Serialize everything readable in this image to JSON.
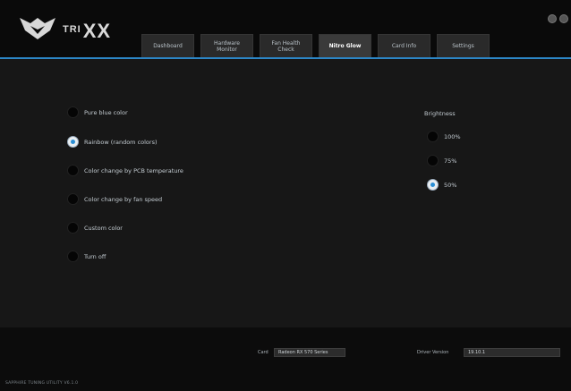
{
  "brand": {
    "prefix": "TRI",
    "main": "XX",
    "accent_color": "#2c86c6"
  },
  "tabs": [
    {
      "label": "Dashboard",
      "active": false
    },
    {
      "label": "Hardware Monitor",
      "active": false
    },
    {
      "label": "Fan Health Check",
      "active": false
    },
    {
      "label": "Nitro Glow",
      "active": true
    },
    {
      "label": "Card Info",
      "active": false
    },
    {
      "label": "Settings",
      "active": false
    }
  ],
  "window_controls": {
    "minimize_icon": "minimize-icon",
    "close_icon": "close-icon"
  },
  "color_options": [
    {
      "label": "Pure blue color",
      "checked": false
    },
    {
      "label": "Rainbow (random colors)",
      "checked": true
    },
    {
      "label": "Color change by PCB temperature",
      "checked": false
    },
    {
      "label": "Color change by fan speed",
      "checked": false
    },
    {
      "label": "Custom color",
      "checked": false
    },
    {
      "label": "Turn off",
      "checked": false
    }
  ],
  "brightness": {
    "title": "Brightness",
    "options": [
      {
        "label": "100%",
        "checked": false
      },
      {
        "label": "75%",
        "checked": false
      },
      {
        "label": "50%",
        "checked": true
      }
    ]
  },
  "footer": {
    "card_label": "Card",
    "card_value": "Radeon RX 570 Series",
    "driver_label": "Driver Version",
    "driver_value": "19.10.1",
    "version_text": "SAPPHIRE TUNING UTILITY V6.1.0"
  }
}
